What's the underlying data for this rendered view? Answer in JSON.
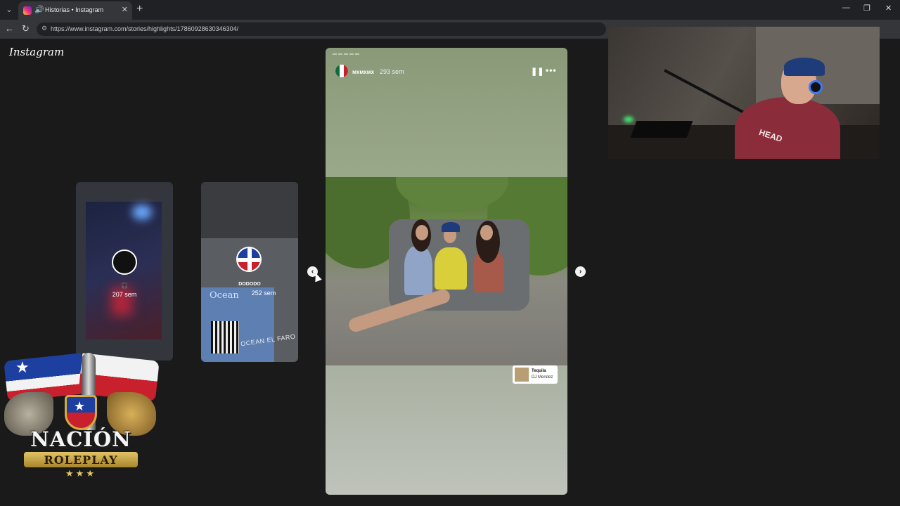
{
  "browser": {
    "tab_title": "Historias • Instagram",
    "url_prefix": "https://",
    "url": "https://www.instagram.com/stories/highlights/17860928630346304/",
    "new_tab_icon": "+",
    "tab_close_icon": "✕",
    "back_icon": "←",
    "reload_icon": "↻",
    "minimize_icon": "—",
    "restore_icon": "❐",
    "close_icon": "✕"
  },
  "instagram": {
    "logo": "Instagram",
    "previews": [
      {
        "time": "207 sem",
        "headphones_icon": "🎧"
      },
      {
        "name": "DODODO",
        "time": "252 sem",
        "flyer_title": "Ocean",
        "flyer_stamp": "OCEAN EL FARO"
      }
    ],
    "story": {
      "username": "мхмхмх",
      "time": "293 sem",
      "pause_icon": "❚❚",
      "more_icon": "•••",
      "music_title": "Tequila",
      "music_artist": "DJ Mendez"
    },
    "prev_arrow": "‹",
    "next_arrow": "›"
  },
  "overlay": {
    "brand_title": "NACIÓN",
    "brand_sub": "ROLEPLAY",
    "brand_stars": "★★★",
    "jacket_logo": "HEAD"
  }
}
